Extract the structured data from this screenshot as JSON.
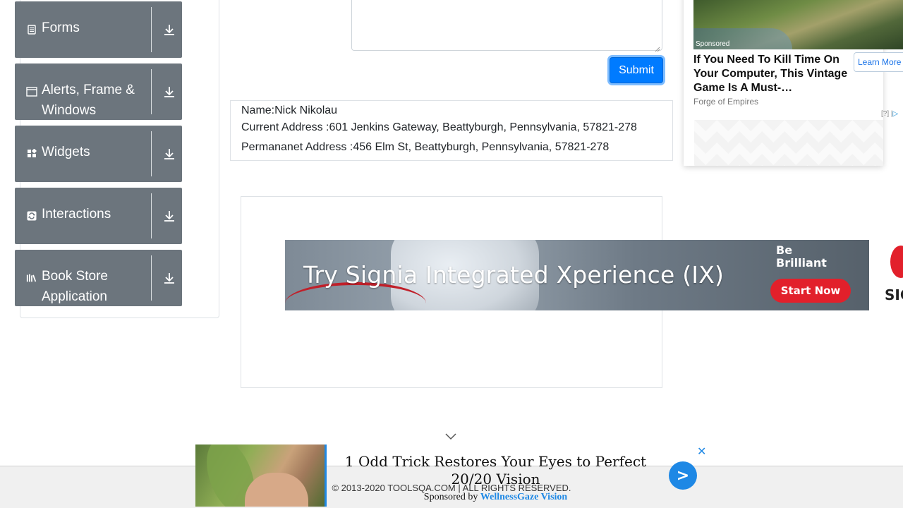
{
  "sidebar": {
    "groups": [
      {
        "label": "Forms",
        "icon": "form-icon"
      },
      {
        "label": "Alerts, Frame & Windows",
        "icon": "window-icon"
      },
      {
        "label": "Widgets",
        "icon": "widgets-icon"
      },
      {
        "label": "Interactions",
        "icon": "interactions-icon"
      },
      {
        "label": "Book Store Application",
        "icon": "books-icon"
      }
    ]
  },
  "form": {
    "submit_label": "Submit"
  },
  "output": {
    "name": "Name:Nick Nikolau",
    "current_address": "Current Address :601 Jenkins Gateway, Beattyburgh, Pennsylvania, 57821-278",
    "permanent_address": "Permananet Address :456 Elm St, Beattyburgh, Pennsylvania, 57821-278"
  },
  "banner_ad": {
    "headline": "Try Signia Integrated Xperience (IX)",
    "tagline": "Be Brilliant",
    "cta": "Start Now",
    "brand_partial": "SIG"
  },
  "side_ad": {
    "sponsored": "Sponsored",
    "title": "If You Need To Kill Time On Your Computer, This Vintage Game Is A Must-…",
    "source": "Forge of Empires",
    "cta": "Learn More",
    "adchoice": "[?]  |"
  },
  "sticky_ad": {
    "title": "1 Odd Trick Restores Your Eyes to Perfect 20/20 Vision",
    "sponsored_prefix": "Sponsored by",
    "sponsor": "WellnessGaze Vision",
    "go": ">",
    "close": "✕"
  },
  "footer": {
    "copyright": "© 2013-2020 TOOLSQA.COM | ALL RIGHTS RESERVED."
  },
  "colors": {
    "group_bg": "#6c757d",
    "submit_bg": "#007bff",
    "ad_blue": "#1e88e5"
  }
}
